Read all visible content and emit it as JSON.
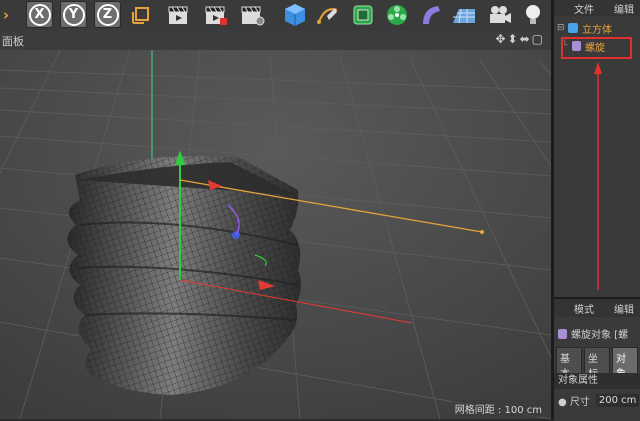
{
  "viewport": {
    "title": "面板",
    "nav_icons": "✥⬍⬌▢",
    "grid_spacing": "网格间距 : 100 cm"
  },
  "toolbar": {
    "axis_x": "X",
    "axis_y": "Y",
    "axis_z": "Z"
  },
  "object_manager": {
    "menu": [
      "文件",
      "编辑"
    ],
    "objects": [
      {
        "label": "立方体",
        "color": "#e8a23a"
      },
      {
        "label": "螺旋",
        "color": "#e8a23a"
      }
    ]
  },
  "attributes": {
    "menu": [
      "模式",
      "编辑"
    ],
    "object_title": "螺旋对象 [螺",
    "tabs": [
      "基本",
      "坐标",
      "对象"
    ],
    "section": "对象属性",
    "size_label": "● 尺寸",
    "size_value": "200 cm"
  },
  "colors": {
    "annotation_red": "#e03030",
    "axis_x": "#e53935",
    "axis_y": "#2ecc40",
    "axis_z": "#3b5bdb"
  }
}
